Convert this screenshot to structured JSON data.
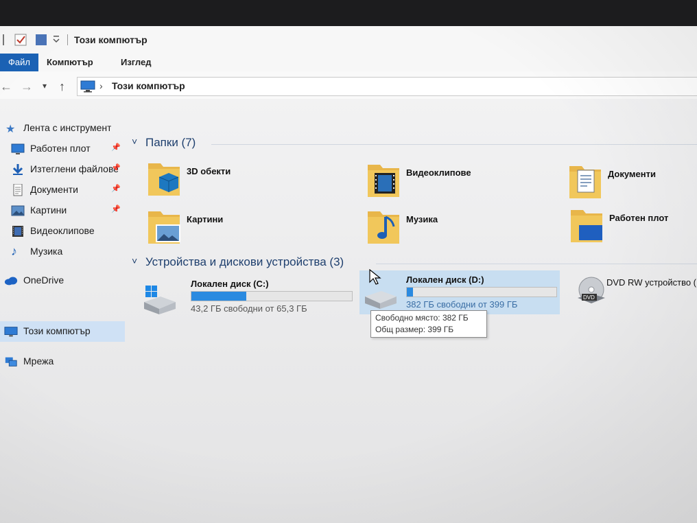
{
  "window": {
    "title": "Този компютър"
  },
  "ribbon": {
    "tabs": [
      "Файл",
      "Компютър",
      "Изглед"
    ]
  },
  "address": {
    "path": "Този компютър"
  },
  "sidebar": {
    "items": [
      {
        "label": "Лента с инструменти",
        "icon": "star-icon"
      },
      {
        "label": "Работен плот",
        "icon": "desktop-icon",
        "pinned": true
      },
      {
        "label": "Изтеглени файлове",
        "icon": "download-icon",
        "pinned": true
      },
      {
        "label": "Документи",
        "icon": "document-icon",
        "pinned": true
      },
      {
        "label": "Картини",
        "icon": "picture-icon",
        "pinned": true
      },
      {
        "label": "Видеоклипове",
        "icon": "video-icon"
      },
      {
        "label": "Музика",
        "icon": "music-icon"
      },
      {
        "label": "OneDrive",
        "icon": "cloud-icon"
      },
      {
        "label": "Този компютър",
        "icon": "computer-icon",
        "selected": true
      },
      {
        "label": "Мрежа",
        "icon": "network-icon"
      }
    ]
  },
  "folders_section": {
    "heading": "Папки (7)",
    "items": [
      {
        "label": "3D обекти",
        "icon": "3d-objects-folder-icon"
      },
      {
        "label": "Видеоклипове",
        "icon": "videos-folder-icon"
      },
      {
        "label": "Документи",
        "icon": "documents-folder-icon"
      },
      {
        "label": "Картини",
        "icon": "pictures-folder-icon"
      },
      {
        "label": "Музика",
        "icon": "music-folder-icon"
      },
      {
        "label": "Работен плот",
        "icon": "desktop-folder-icon"
      }
    ]
  },
  "devices_section": {
    "heading": "Устройства и дискови устройства (3)",
    "drives": [
      {
        "label": "Локален диск (C:)",
        "free_text": "43,2 ГБ свободни от 65,3 ГБ",
        "used_fraction": 0.34,
        "icon": "windows-drive-icon"
      },
      {
        "label": "Локален диск (D:)",
        "free_text": "382 ГБ свободни от 399 ГБ",
        "used_fraction": 0.04,
        "icon": "hard-drive-icon",
        "hovered": true
      },
      {
        "label": "DVD RW устройство (E:",
        "icon": "dvd-drive-icon"
      }
    ]
  },
  "tooltip": {
    "line1": "Свободно място: 382 ГБ",
    "line2": "Общ размер: 399 ГБ"
  },
  "colors": {
    "accent": "#1b62b5",
    "bar_fill": "#2a8ae0",
    "hover": "#c8def1",
    "folder": "#e8b64a"
  }
}
